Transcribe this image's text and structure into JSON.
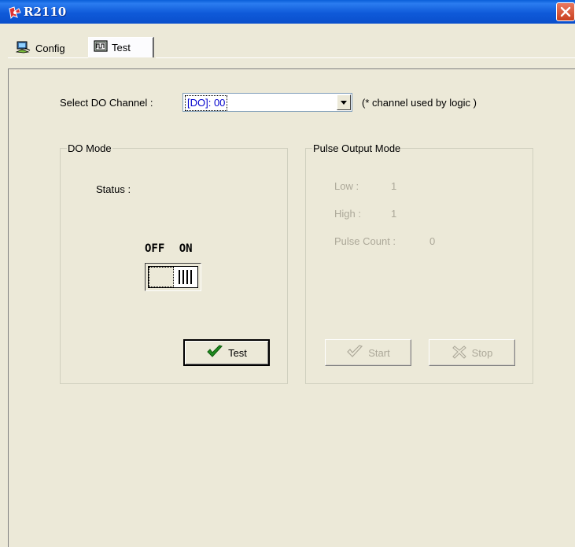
{
  "window": {
    "title": "R2110"
  },
  "tabs": [
    {
      "label": "Config",
      "icon": "network-monitor-icon",
      "selected": false
    },
    {
      "label": "Test",
      "icon": "waveform-icon",
      "selected": true
    }
  ],
  "channel": {
    "label": "Select DO Channel :",
    "selected": "[DO]: 00",
    "note": "(* channel used by logic )"
  },
  "do_mode": {
    "title": "DO Mode",
    "status_label": "Status :",
    "switch_off_label": "OFF",
    "switch_on_label": "ON",
    "test_button": "Test"
  },
  "pulse_mode": {
    "title": "Pulse Output Mode",
    "low_label": "Low :",
    "low_value": "1",
    "high_label": "High :",
    "high_value": "1",
    "count_label": "Pulse Count :",
    "count_value": "0",
    "start_button": "Start",
    "stop_button": "Stop"
  },
  "colors": {
    "titlebar": "#0a5fd8",
    "face": "#ece9d8",
    "disabled_text": "#aca899",
    "select_text": "#0000cc"
  }
}
